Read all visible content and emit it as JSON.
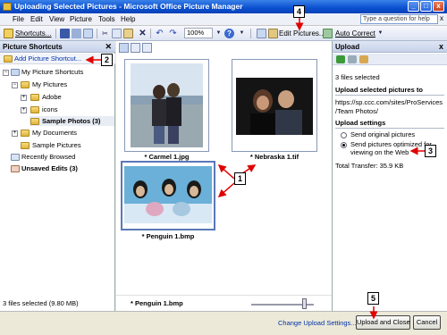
{
  "window": {
    "title": "Uploading Selected Pictures - Microsoft Office Picture Manager",
    "controls": [
      "_",
      "□",
      "x"
    ]
  },
  "menubar": {
    "items": [
      "File",
      "Edit",
      "View",
      "Picture",
      "Tools",
      "Help"
    ],
    "help_placeholder": "Type a question for help",
    "close_glyph": "x"
  },
  "toolbar": {
    "shortcuts_label": "Shortcuts...",
    "zoom_value": "100%",
    "edit_pictures_label": "Edit Pictures...",
    "auto_correct_label": "Auto Correct"
  },
  "left_pane": {
    "title": "Picture Shortcuts",
    "add_shortcut": "Add Picture Shortcut...",
    "tree": {
      "my_shortcuts": "My Picture Shortcuts",
      "my_pictures": "My Pictures",
      "adobe": "Adobe",
      "icons": "icons",
      "sample_photos": "Sample Photos (3)",
      "my_documents": "My Documents",
      "sample_pictures": "Sample Pictures",
      "recently_browsed": "Recently Browsed",
      "unsaved_edits": "Unsaved Edits (3)"
    },
    "status": "3 files selected (9.80 MB)"
  },
  "center": {
    "thumbnails": [
      {
        "caption": "* Carmel 1.jpg"
      },
      {
        "caption": "* Nebraska 1.tif"
      },
      {
        "caption": "* Penguin 1.bmp"
      }
    ],
    "current_file": "* Penguin 1.bmp"
  },
  "right_pane": {
    "title": "Upload",
    "close_glyph": "x",
    "files_selected": "3 files selected",
    "upload_to_heading": "Upload selected pictures to",
    "url_line1": "https://sp.ccc.com/sites/ProServices",
    "url_line2": "/Team Photos/",
    "settings_heading": "Upload settings",
    "option_original": "Send original pictures",
    "option_web_line1": "Send pictures optimized for",
    "option_web_line2": "viewing on the Web",
    "total_transfer": "Total Transfer:   35.9 KB"
  },
  "footer": {
    "change_settings": "Change Upload Settings...",
    "upload_close": "Upload and Close",
    "cancel": "Cancel"
  },
  "callouts": [
    "1",
    "2",
    "3",
    "4",
    "5"
  ]
}
